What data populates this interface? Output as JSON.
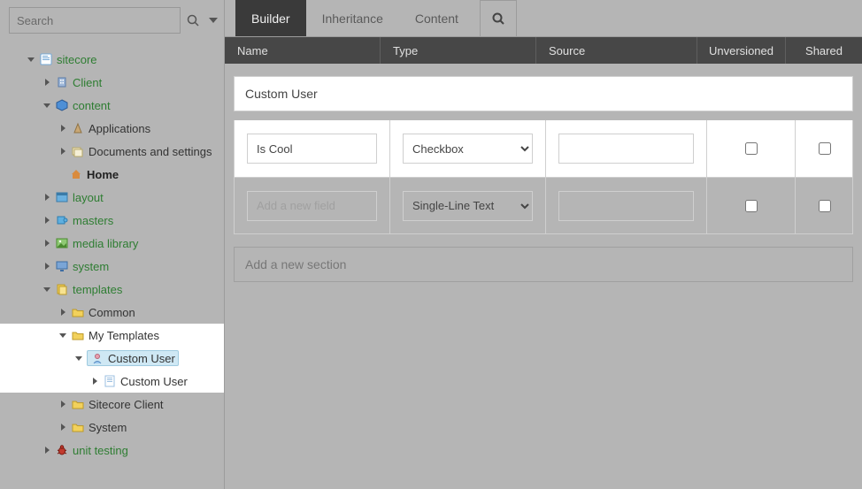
{
  "search": {
    "placeholder": "Search"
  },
  "tree": {
    "sitecore": "sitecore",
    "client": "Client",
    "content": "content",
    "applications": "Applications",
    "documents": "Documents and settings",
    "home": "Home",
    "layout": "layout",
    "masters": "masters",
    "media": "media library",
    "system": "system",
    "templates": "templates",
    "common": "Common",
    "mytemplates": "My Templates",
    "customuser": "Custom User",
    "customuser_child": "Custom User",
    "sitecore_client": "Sitecore Client",
    "system_tpl": "System",
    "unit_testing": "unit testing"
  },
  "tabs": {
    "builder": "Builder",
    "inheritance": "Inheritance",
    "content": "Content"
  },
  "columns": {
    "name": "Name",
    "type": "Type",
    "source": "Source",
    "unversioned": "Unversioned",
    "shared": "Shared"
  },
  "section": {
    "name": "Custom User"
  },
  "fields": {
    "row1": {
      "name": "Is Cool",
      "type": "Checkbox",
      "source": ""
    },
    "row2": {
      "name_placeholder": "Add a new field",
      "type": "Single-Line Text",
      "source": ""
    }
  },
  "type_options": {
    "checkbox": "Checkbox",
    "singleline": "Single-Line Text"
  },
  "add_section_placeholder": "Add a new section"
}
